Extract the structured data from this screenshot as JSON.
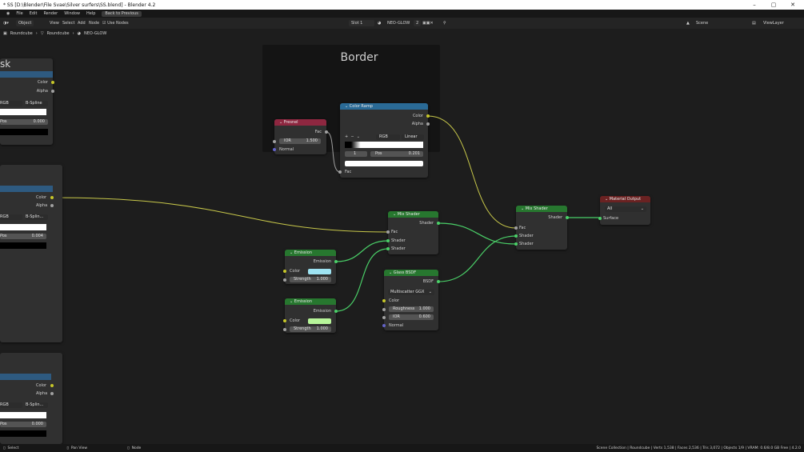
{
  "window": {
    "title": "* SS [D:\\Blender\\File Svae\\Silver surfers\\SS.blend] - Blender 4.2"
  },
  "menu": {
    "items": [
      "File",
      "Edit",
      "Render",
      "Window",
      "Help"
    ],
    "back_label": "Back to Previous"
  },
  "toolbar": {
    "mode": "Object",
    "view": "View",
    "select": "Select",
    "add": "Add",
    "node": "Node",
    "use_nodes": "Use Nodes",
    "slot": "Slot 1",
    "material": "NEO-GLOW",
    "users": "2",
    "scene": "Scene",
    "view_layer": "ViewLayer"
  },
  "breadcrumb": {
    "a": "Roundcube",
    "b": "Roundcube",
    "c": "NEO-GLOW"
  },
  "frame": {
    "label": "Border"
  },
  "left_nodes": {
    "title_fragment": "sk",
    "color_label": "Color",
    "alpha_label": "Alpha",
    "rgb": "RGB",
    "bspline_1": "B-Spline",
    "bspline_2": "B-Splin...",
    "pos_label": "Pos",
    "pos_1": "0.000",
    "pos_2": "0.004",
    "pos_3": "0.000"
  },
  "fresnel": {
    "title": "Fresnel",
    "fac": "Fac",
    "ior_label": "IOR",
    "ior": "1.500",
    "normal": "Normal"
  },
  "color_ramp": {
    "title": "Color Ramp",
    "color": "Color",
    "alpha": "Alpha",
    "mode": "RGB",
    "interp": "Linear",
    "index": "1",
    "pos_label": "Pos",
    "pos": "0.201",
    "fac": "Fac"
  },
  "mix_shader_1": {
    "title": "Mix Shader",
    "shader_out": "Shader",
    "fac": "Fac",
    "shader_a": "Shader",
    "shader_b": "Shader"
  },
  "mix_shader_2": {
    "title": "Mix Shader",
    "shader_out": "Shader",
    "fac": "Fac",
    "shader_a": "Shader",
    "shader_b": "Shader"
  },
  "material_output": {
    "title": "Material Output",
    "target": "All",
    "surface": "Surface"
  },
  "emission_1": {
    "title": "Emission",
    "out": "Emission",
    "color": "Color",
    "strength_label": "Strength",
    "strength": "1.000",
    "swatch": "#9ee3f2"
  },
  "emission_2": {
    "title": "Emission",
    "out": "Emission",
    "color": "Color",
    "strength_label": "Strength",
    "strength": "1.000",
    "swatch": "#b7f59a"
  },
  "glass": {
    "title": "Glass BSDF",
    "out": "BSDF",
    "dist": "Multiscatter GGX",
    "color": "Color",
    "rough_label": "Roughness",
    "rough": "1.000",
    "ior_label": "IOR",
    "ior": "0.600",
    "normal": "Normal"
  },
  "status": {
    "select": "Select",
    "pan": "Pan View",
    "node": "Node",
    "stats": "Scene Collection | Roundcube | Verts 1,538 | Faces 2,536 | Tris 3,072 | Objects 1/9 | VRAM: 0.6/8.0 GB Free | 4.2.0"
  },
  "colors": {
    "ramp_header": "#2a6a96",
    "converter_header": "#2e5a80",
    "shader_header": "#27772f",
    "input_header": "#8e2740",
    "output_header": "#6a2222",
    "wire_color": "#c8c84a",
    "wire_shader": "#4ad068",
    "wire_gray": "#a0a0a0"
  }
}
